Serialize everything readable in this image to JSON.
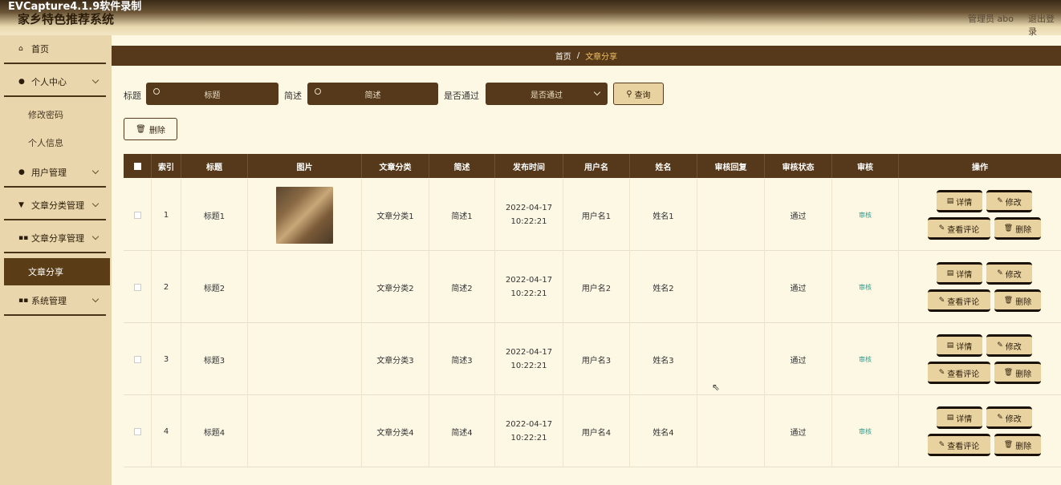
{
  "topbar": {
    "watermark": "EVCapture4.1.9软件录制",
    "system_title": "家乡特色推荐系统",
    "admin_label": "管理员 abo",
    "logout_label": "退出登录"
  },
  "sidebar": {
    "home": "首页",
    "personal_center": "个人中心",
    "change_password": "修改密码",
    "personal_info": "个人信息",
    "user_management": "用户管理",
    "article_category_management": "文章分类管理",
    "article_share_management": "文章分享管理",
    "article_share": "文章分享",
    "system_management": "系统管理"
  },
  "breadcrumb": {
    "home": "首页",
    "separator": "/",
    "current": "文章分享"
  },
  "search": {
    "title_label": "标题",
    "title_placeholder": "标题",
    "summary_label": "简述",
    "summary_placeholder": "简述",
    "approved_label": "是否通过",
    "approved_value": "是否通过",
    "query_button": "查询"
  },
  "toolbar": {
    "delete_button": "删除"
  },
  "table": {
    "headers": {
      "index": "索引",
      "title": "标题",
      "image": "图片",
      "category": "文章分类",
      "summary": "简述",
      "publish_time": "发布时间",
      "username": "用户名",
      "name": "姓名",
      "review_reply": "审核回复",
      "review_status": "审核状态",
      "review": "审核",
      "actions": "操作"
    },
    "rows": [
      {
        "index": "1",
        "title": "标题1",
        "has_image": true,
        "category": "文章分类1",
        "summary": "简述1",
        "publish_time": "2022-04-17 10:22:21",
        "username": "用户名1",
        "name": "姓名1",
        "review_reply": "",
        "review_status": "通过",
        "review_link": "审核"
      },
      {
        "index": "2",
        "title": "标题2",
        "has_image": false,
        "category": "文章分类2",
        "summary": "简述2",
        "publish_time": "2022-04-17 10:22:21",
        "username": "用户名2",
        "name": "姓名2",
        "review_reply": "",
        "review_status": "通过",
        "review_link": "审核"
      },
      {
        "index": "3",
        "title": "标题3",
        "has_image": false,
        "category": "文章分类3",
        "summary": "简述3",
        "publish_time": "2022-04-17 10:22:21",
        "username": "用户名3",
        "name": "姓名3",
        "review_reply": "",
        "review_status": "通过",
        "review_link": "审核"
      },
      {
        "index": "4",
        "title": "标题4",
        "has_image": false,
        "category": "文章分类4",
        "summary": "简述4",
        "publish_time": "2022-04-17 10:22:21",
        "username": "用户名4",
        "name": "姓名4",
        "review_reply": "",
        "review_status": "通过",
        "review_link": "审核"
      }
    ],
    "actions": {
      "detail": "详情",
      "edit": "修改",
      "view_comments": "查看评论",
      "delete": "删除"
    }
  },
  "colors": {
    "accent_dark": "#55391a",
    "sidebar_bg": "#e9d6ac",
    "page_bg": "#fdf8e4",
    "button_bg": "#e8d2a0",
    "breadcrumb_current": "#f0c060",
    "audit_link": "#2e9a8a"
  }
}
